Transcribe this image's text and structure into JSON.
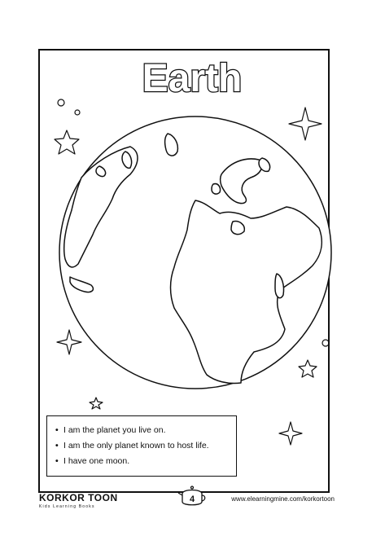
{
  "title": "Earth",
  "facts": [
    "I am the planet you live on.",
    "I am the only planet known to host life.",
    "I have one moon."
  ],
  "footer": {
    "brand": "KORKOR TOON",
    "tagline": "Kids Learning Books",
    "page_number": "4",
    "url": "www.elearningmine.com/korkortoon"
  }
}
